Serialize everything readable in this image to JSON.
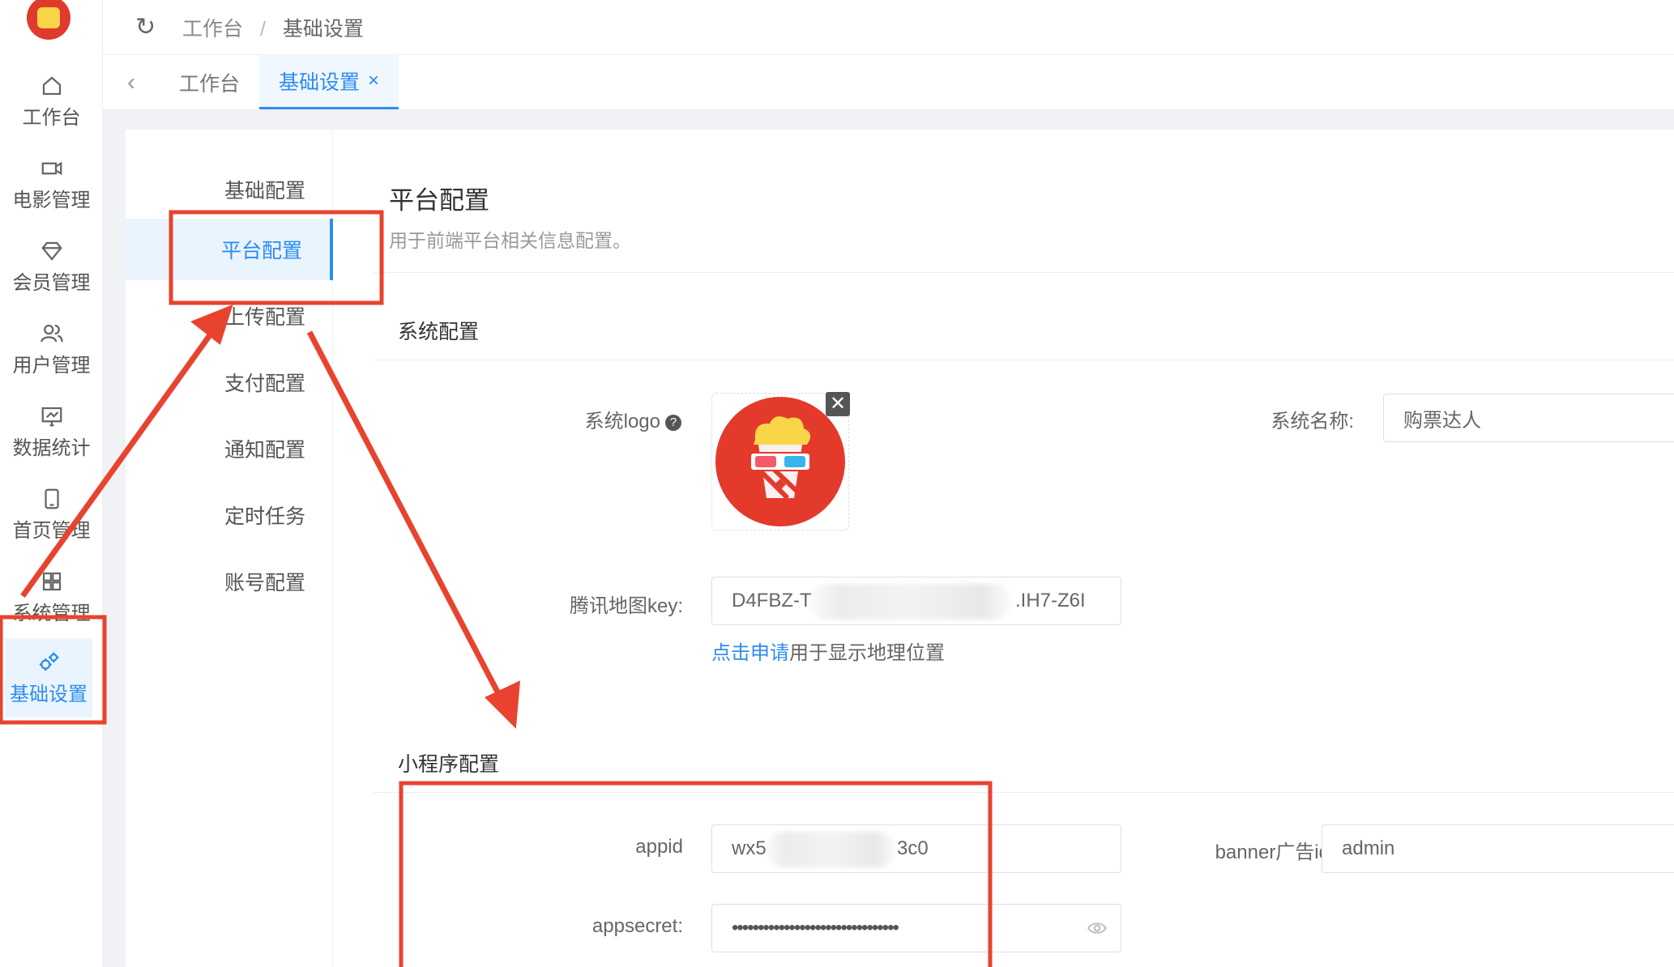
{
  "rail": {
    "items": [
      {
        "label": "工作台",
        "icon": "home-icon"
      },
      {
        "label": "电影管理",
        "icon": "video-icon"
      },
      {
        "label": "会员管理",
        "icon": "diamond-icon"
      },
      {
        "label": "用户管理",
        "icon": "users-icon"
      },
      {
        "label": "数据统计",
        "icon": "chart-icon"
      },
      {
        "label": "首页管理",
        "icon": "tablet-icon"
      },
      {
        "label": "系统管理",
        "icon": "grid-icon"
      },
      {
        "label": "基础设置",
        "icon": "gears-icon"
      }
    ]
  },
  "breadcrumb": {
    "first": "工作台",
    "separator": "/",
    "current": "基础设置"
  },
  "tabs": [
    {
      "label": "工作台"
    },
    {
      "label": "基础设置",
      "close": "×"
    }
  ],
  "submenu": [
    "基础配置",
    "平台配置",
    "上传配置",
    "支付配置",
    "通知配置",
    "定时任务",
    "账号配置"
  ],
  "main": {
    "title": "平台配置",
    "description": "用于前端平台相关信息配置。",
    "system_section": "系统配置",
    "logo_label": "系统logo",
    "help_glyph": "?",
    "logo_close": "✕",
    "system_name_label": "系统名称:",
    "system_name_value": "购票达人",
    "map_key_label": "腾讯地图key:",
    "map_key_prefix": "D4FBZ-T",
    "map_key_suffix": ".IH7-Z6I",
    "map_hint_link": "点击申请",
    "map_hint_text": "用于显示地理位置",
    "mini_section": "小程序配置",
    "appid_label": "appid",
    "appid_prefix": "wx5",
    "appid_suffix": "3c0",
    "banner_label": "banner广告id",
    "banner_value": "admin",
    "appsecret_label": "appsecret:",
    "appsecret_value": "••••••••••••••••••••••••••••••••"
  },
  "colors": {
    "accent": "#2d8cf0",
    "annotation": "#e8432f"
  }
}
